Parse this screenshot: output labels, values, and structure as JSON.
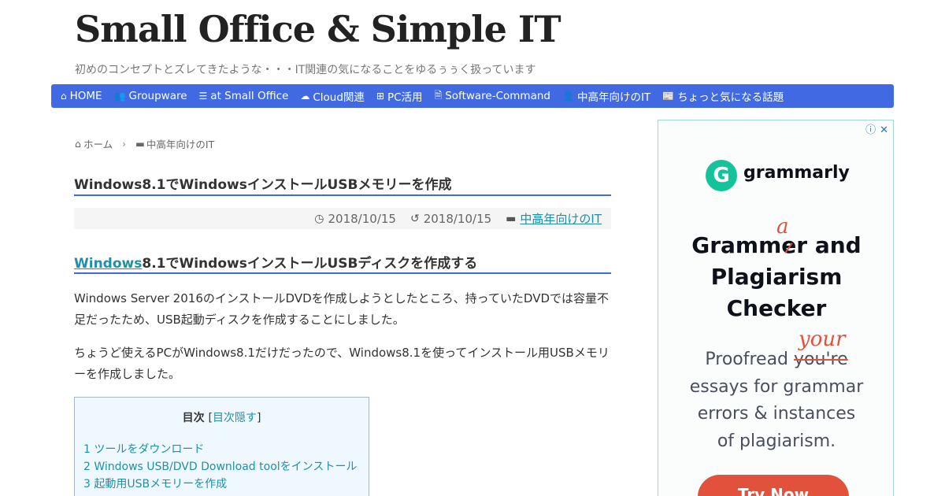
{
  "site": {
    "title": "Small Office & Simple IT",
    "tagline": "初めのコンセプトとズレてきたような・・・IT関連の気になることをゆるぅぅく扱っています"
  },
  "nav": {
    "items": [
      {
        "label": "HOME",
        "icon": "home-icon",
        "glyph": "⌂"
      },
      {
        "label": "Groupware",
        "icon": "users-icon",
        "glyph": "👥"
      },
      {
        "label": "at Small Office",
        "icon": "server-icon",
        "glyph": "☰"
      },
      {
        "label": "Cloud関連",
        "icon": "cloud-icon",
        "glyph": "☁"
      },
      {
        "label": "PC活用",
        "icon": "windows-icon",
        "glyph": "⊞"
      },
      {
        "label": "Software-Command",
        "icon": "file-icon",
        "glyph": "🗎"
      },
      {
        "label": "中高年向けのIT",
        "icon": "user-icon",
        "glyph": "👤"
      },
      {
        "label": "ちょっと気になる話題",
        "icon": "newspaper-icon",
        "glyph": "📰"
      }
    ],
    "color": "#4169e1"
  },
  "breadcrumb": {
    "home": "ホーム",
    "category": "中高年向けのIT"
  },
  "post": {
    "title": "Windows8.1でWindowsインストールUSBメモリーを作成",
    "published": "2018/10/15",
    "updated": "2018/10/15",
    "category": "中高年向けのIT",
    "h2_link": "Windows",
    "h2_rest": "8.1でWindowsインストールUSBディスクを作成する",
    "para1": "Windows Server 2016のインストールDVDを作成しようとしたところ、持っていたDVDでは容量不足だったため、USB起動ディスクを作成することにしました。",
    "para2": "ちょうど使えるPCがWindows8.1だけだったので、Windows8.1を使ってインストール用USBメモリーを作成しました。"
  },
  "toc": {
    "title": "目次",
    "toggle": "目次隠す",
    "items": [
      "1 ツールをダウンロード",
      "2 Windows USB/DVD Download toolをインストール",
      "3 起動用USBメモリーを作成"
    ]
  },
  "ad": {
    "brand": "grammarly",
    "headline_1a": "Gramm",
    "headline_1b": "e",
    "headline_1c": "r and",
    "headline_correction": "a",
    "headline_2": "Plagiarism",
    "headline_3": "Checker",
    "body_1a": "Proofread ",
    "body_1b": "you're",
    "body_correction": "your",
    "body_2": "essays for grammar",
    "body_3": "errors & instances",
    "body_4": "of plagiarism.",
    "cta": "Try Now",
    "accent": "#15c39a",
    "cta_color": "#e2513b"
  }
}
